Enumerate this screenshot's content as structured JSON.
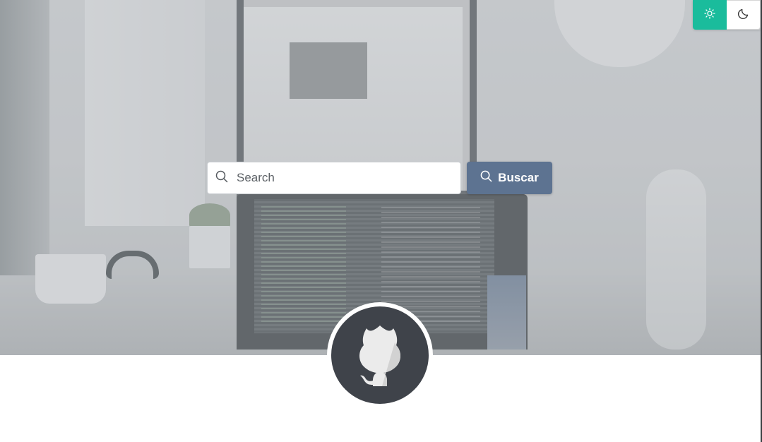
{
  "theme_toggle": {
    "light_icon": "sun-icon",
    "dark_icon": "moon-icon",
    "active": "light",
    "accent_color": "#1abc9c"
  },
  "search": {
    "placeholder": "Search",
    "value": "",
    "icon": "search-icon",
    "button_label": "Buscar",
    "button_color": "#5d7391"
  },
  "profile": {
    "avatar_icon": "github-octocat-icon"
  }
}
